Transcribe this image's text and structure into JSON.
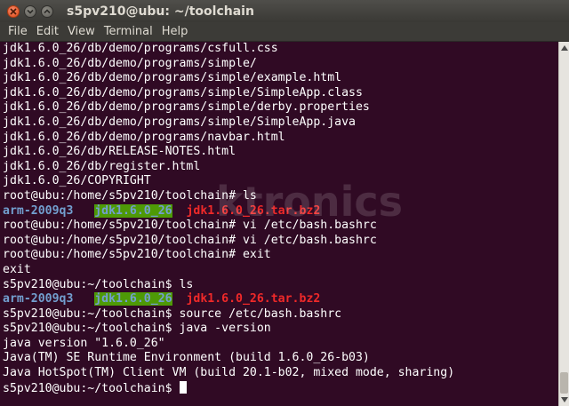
{
  "window": {
    "title": "s5pv210@ubu: ~/toolchain"
  },
  "menu": {
    "file": "File",
    "edit": "Edit",
    "view": "View",
    "terminal": "Terminal",
    "help": "Help"
  },
  "terminal": {
    "lines": [
      "jdk1.6.0_26/db/demo/programs/csfull.css",
      "jdk1.6.0_26/db/demo/programs/simple/",
      "jdk1.6.0_26/db/demo/programs/simple/example.html",
      "jdk1.6.0_26/db/demo/programs/simple/SimpleApp.class",
      "jdk1.6.0_26/db/demo/programs/simple/derby.properties",
      "jdk1.6.0_26/db/demo/programs/simple/SimpleApp.java",
      "jdk1.6.0_26/db/demo/programs/navbar.html",
      "jdk1.6.0_26/db/RELEASE-NOTES.html",
      "jdk1.6.0_26/db/register.html",
      "jdk1.6.0_26/COPYRIGHT",
      "root@ubu:/home/s5pv210/toolchain# ls"
    ],
    "ls1": {
      "dir1": "arm-2009q3",
      "dir2": "jdk1.6.0_26",
      "file1": "jdk1.6.0_26.tar.bz2"
    },
    "lines2": [
      "root@ubu:/home/s5pv210/toolchain# vi /etc/bash.bashrc",
      "root@ubu:/home/s5pv210/toolchain# vi /etc/bash.bashrc",
      "root@ubu:/home/s5pv210/toolchain# exit",
      "exit",
      "s5pv210@ubu:~/toolchain$ ls"
    ],
    "ls2": {
      "dir1": "arm-2009q3",
      "dir2": "jdk1.6.0_26",
      "file1": "jdk1.6.0_26.tar.bz2"
    },
    "lines3": [
      "s5pv210@ubu:~/toolchain$ source /etc/bash.bashrc",
      "s5pv210@ubu:~/toolchain$ java -version",
      "java version \"1.6.0_26\"",
      "Java(TM) SE Runtime Environment (build 1.6.0_26-b03)",
      "Java HotSpot(TM) Client VM (build 20.1-b02, mixed mode, sharing)"
    ],
    "prompt": "s5pv210@ubu:~/toolchain$ "
  },
  "watermark": {
    "text": "ktronics"
  },
  "colors": {
    "terminal_bg": "#300a24",
    "directory": "#729fcf",
    "highlight_bg": "#4e9a06",
    "archive": "#ef2929"
  }
}
